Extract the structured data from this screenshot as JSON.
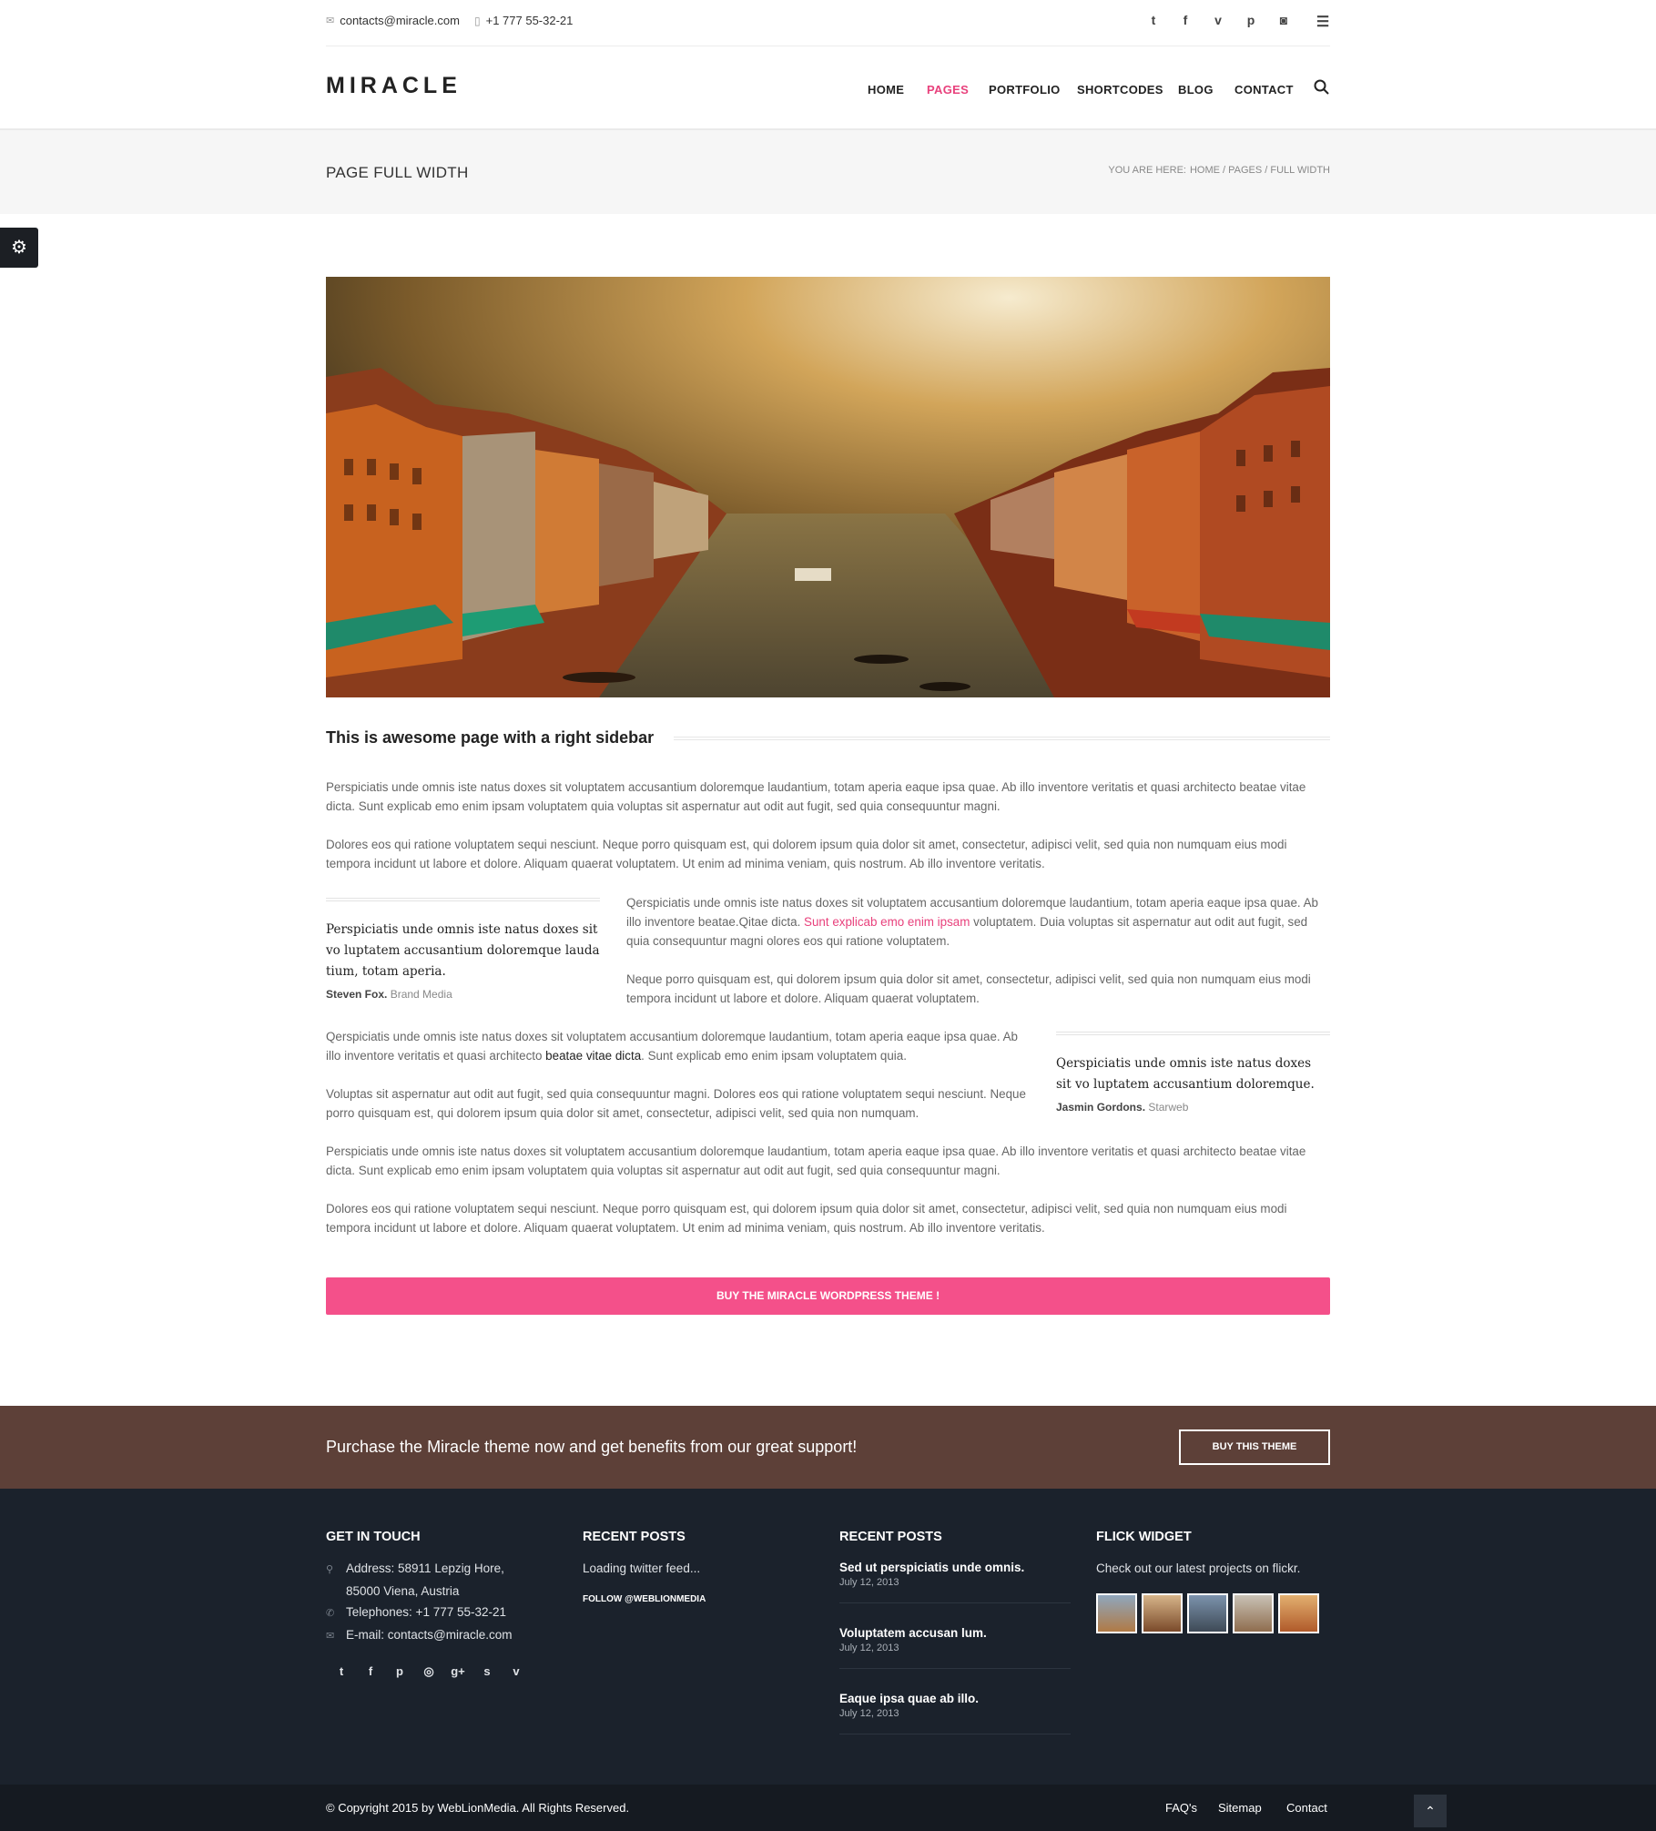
{
  "topbar": {
    "email": "contacts@miracle.com",
    "phone": "+1 777 55-32-21",
    "social": [
      "twitter-icon",
      "facebook-icon",
      "vimeo-icon",
      "pinterest-icon",
      "instagram-icon"
    ]
  },
  "header": {
    "logo": "MIRACLE",
    "nav": [
      "HOME",
      "PAGES",
      "PORTFOLIO",
      "SHORTCODES",
      "BLOG",
      "CONTACT"
    ],
    "active_nav": "PAGES"
  },
  "page_title": {
    "title": "PAGE FULL WIDTH",
    "breadcrumb_prefix": "YOU ARE HERE:",
    "breadcrumb": "HOME / PAGES / FULL WIDTH"
  },
  "content": {
    "heading": "This is awesome page with a right sidebar",
    "p1": "Perspiciatis unde omnis iste natus doxes sit voluptatem accusantium doloremque laudantium, totam aperia eaque ipsa quae. Ab illo inventore veritatis et quasi architecto beatae vitae dicta. Sunt explicab emo enim ipsam voluptatem quia voluptas sit aspernatur aut odit aut fugit, sed quia consequuntur magni.",
    "p2": "Dolores eos qui ratione voluptatem sequi nesciunt. Neque porro quisquam est, qui dolorem ipsum quia dolor sit amet, consectetur, adipisci velit, sed quia non numquam eius modi tempora incidunt ut labore et dolore. Aliquam quaerat voluptatem. Ut enim ad minima veniam, quis nostrum. Ab illo inventore veritatis.",
    "quote1": {
      "text": "Perspiciatis unde omnis iste natus doxes sit vo luptatem accusantium doloremque lauda tium, totam aperia.",
      "author": "Steven Fox.",
      "company": "Brand Media"
    },
    "p3a": "Qerspiciatis unde omnis iste natus doxes sit voluptatem accusantium doloremque laudantium, totam aperia eaque ipsa quae. Ab illo inventore beatae.Qitae dicta.",
    "p3_link": "Sunt explicab emo enim ipsam",
    "p3b": "voluptatem. Duia voluptas sit aspernatur aut odit aut fugit, sed quia consequuntur magni olores eos qui ratione voluptatem.",
    "p4": "Neque porro quisquam est, qui dolorem ipsum quia dolor sit amet, consectetur, adipisci velit, sed quia non numquam eius modi tempora incidunt ut labore et dolore. Aliquam quaerat voluptatem.",
    "p5a": "Qerspiciatis unde omnis iste natus doxes sit voluptatem accusantium doloremque laudantium, totam aperia eaque ipsa quae. Ab illo inventore veritatis et quasi architecto",
    "p5_dark": "beatae vitae dicta",
    "p5b": ". Sunt explicab emo enim ipsam voluptatem quia.",
    "p6": "Voluptas sit aspernatur aut odit aut fugit, sed quia consequuntur magni. Dolores eos qui ratione voluptatem sequi nesciunt. Neque porro quisquam est, qui dolorem ipsum quia dolor sit amet, consectetur, adipisci velit, sed quia non numquam.",
    "quote2": {
      "text": "Qerspiciatis unde omnis iste natus doxes sit vo luptatem accusantium doloremque.",
      "author": "Jasmin Gordons.",
      "company": "Starweb"
    },
    "p7": "Perspiciatis unde omnis iste natus doxes sit voluptatem accusantium doloremque laudantium, totam aperia eaque ipsa quae. Ab illo inventore veritatis et quasi architecto beatae vitae dicta. Sunt explicab emo enim ipsam voluptatem quia voluptas sit aspernatur aut odit aut fugit, sed quia consequuntur magni.",
    "p8": "Dolores eos qui ratione voluptatem sequi nesciunt. Neque porro quisquam est, qui dolorem ipsum quia dolor sit amet, consectetur, adipisci velit, sed quia non numquam eius modi tempora incidunt ut labore et dolore. Aliquam quaerat voluptatem. Ut enim ad minima veniam, quis nostrum. Ab illo inventore veritatis.",
    "buy_button": "BUY THE MIRACLE WORDPRESS THEME !"
  },
  "promo": {
    "text": "Purchase the Miracle theme now and get benefits from our great support!",
    "button": "BUY THIS THEME"
  },
  "footer": {
    "touch": {
      "title": "GET IN TOUCH",
      "address1": "Address: 58911 Lepzig Hore,",
      "address2": "85000 Viena, Austria",
      "phone": "Telephones: +1 777 55-32-21",
      "email": "E-mail: contacts@miracle.com",
      "social": [
        "twitter-icon",
        "facebook-icon",
        "pinterest-icon",
        "dribbble-icon",
        "google-plus-icon",
        "skype-icon",
        "vimeo-icon"
      ]
    },
    "twitter": {
      "title": "RECENT POSTS",
      "loading": "Loading twitter feed...",
      "follow": "FOLLOW @WEBLIONMEDIA"
    },
    "posts": {
      "title": "RECENT POSTS",
      "items": [
        {
          "title": "Sed ut perspiciatis unde omnis.",
          "date": "July 12, 2013"
        },
        {
          "title": "Voluptatem accusan lum.",
          "date": "July 12, 2013"
        },
        {
          "title": "Eaque ipsa quae ab illo.",
          "date": "July 12, 2013"
        }
      ]
    },
    "flickr": {
      "title": "FLICK WIDGET",
      "text": "Check out our latest projects on flickr."
    }
  },
  "bottom": {
    "copyright": "© Copyright 2015 by WebLionMedia. All Rights Reserved.",
    "links": [
      "FAQ's",
      "Sitemap",
      "Contact"
    ]
  },
  "colors": {
    "accent": "#f4508a",
    "promo_bg": "#5d4038",
    "footer_bg": "#1b222c"
  }
}
